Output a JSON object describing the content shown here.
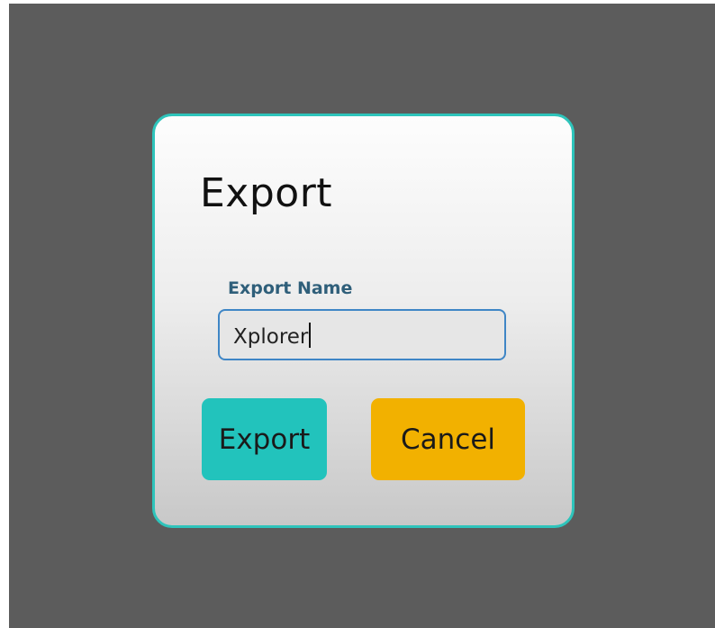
{
  "dialog": {
    "title": "Export",
    "field_label": "Export Name",
    "field_value": "Xplorer",
    "export_button": "Export",
    "cancel_button": "Cancel"
  },
  "colors": {
    "backdrop": "#5c5c5c",
    "dialog_border": "#2ec4bb",
    "export_button": "#22c3bc",
    "cancel_button": "#f2b100",
    "field_border": "#3f86c6",
    "label_text": "#2f5f7a"
  }
}
